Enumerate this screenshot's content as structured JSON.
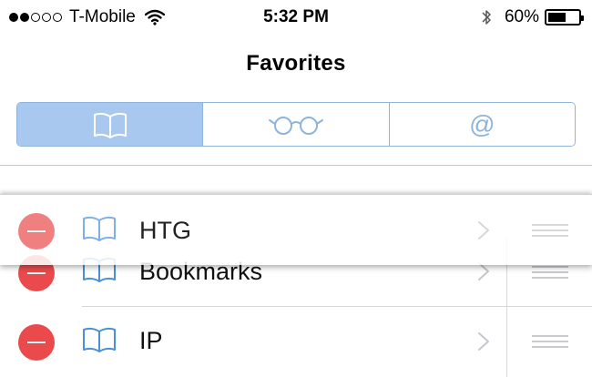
{
  "status_bar": {
    "carrier": "T-Mobile",
    "signal_bars_filled": 2,
    "signal_bars_total": 5,
    "time": "5:32 PM",
    "battery_percent_label": "60%",
    "battery_level": 0.6,
    "icons": [
      "wifi-icon",
      "bluetooth-icon",
      "battery-icon"
    ]
  },
  "header": {
    "title": "Favorites"
  },
  "segmented_control": {
    "segments": [
      {
        "icon": "book-icon",
        "selected": true
      },
      {
        "icon": "glasses-icon",
        "selected": false
      },
      {
        "icon": "at-icon",
        "glyph": "@",
        "selected": false
      }
    ]
  },
  "bookmarks": {
    "items": [
      {
        "label": "Bookmarks",
        "icon": "book-icon"
      },
      {
        "label": "IP",
        "icon": "book-icon"
      }
    ],
    "dragging_item": {
      "label": "HTG",
      "icon": "book-icon"
    }
  },
  "colors": {
    "accent": "#4a90d9",
    "segment_selected": "#a9c8ef",
    "segment_border": "#8fb4dc",
    "delete_red": "#ea4a4b"
  }
}
